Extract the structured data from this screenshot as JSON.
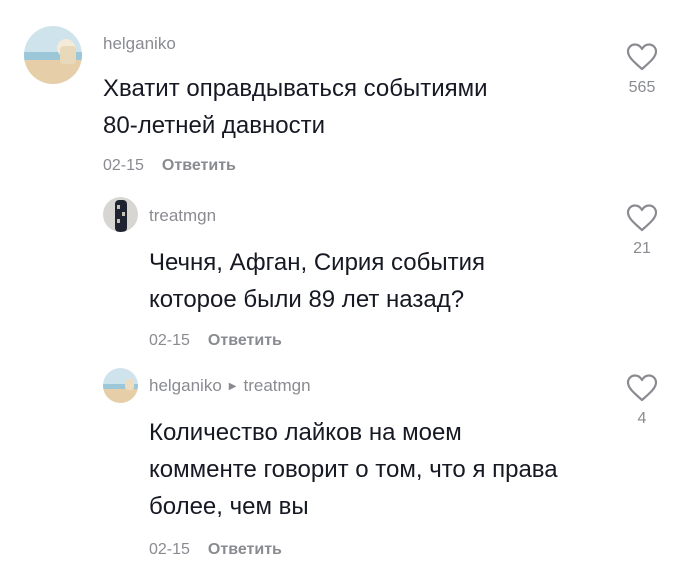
{
  "comments": [
    {
      "username": "helganiko",
      "text": "Хватит оправдываться событиями\n80-летней давности",
      "date": "02-15",
      "reply_label": "Ответить",
      "likes": "565",
      "avatar_icon": "beach-photo-avatar"
    },
    {
      "username": "treatmgn",
      "text": "Чечня, Афган, Сирия события\nкоторое были 89 лет назад?",
      "date": "02-15",
      "reply_label": "Ответить",
      "likes": "21",
      "avatar_icon": "dark-photo-avatar"
    },
    {
      "username": "helganiko",
      "reply_to": "treatmgn",
      "text": "Количество лайков на моем\nкомменте говорит о том, что я права\nболее, чем вы",
      "date": "02-15",
      "reply_label": "Ответить",
      "likes": "4",
      "avatar_icon": "beach-photo-avatar"
    }
  ],
  "icons": {
    "like": "heart-outline-icon",
    "reply_arrow": "caret-right-icon"
  },
  "colors": {
    "text": "#161823",
    "secondary": "#8a8b91"
  }
}
